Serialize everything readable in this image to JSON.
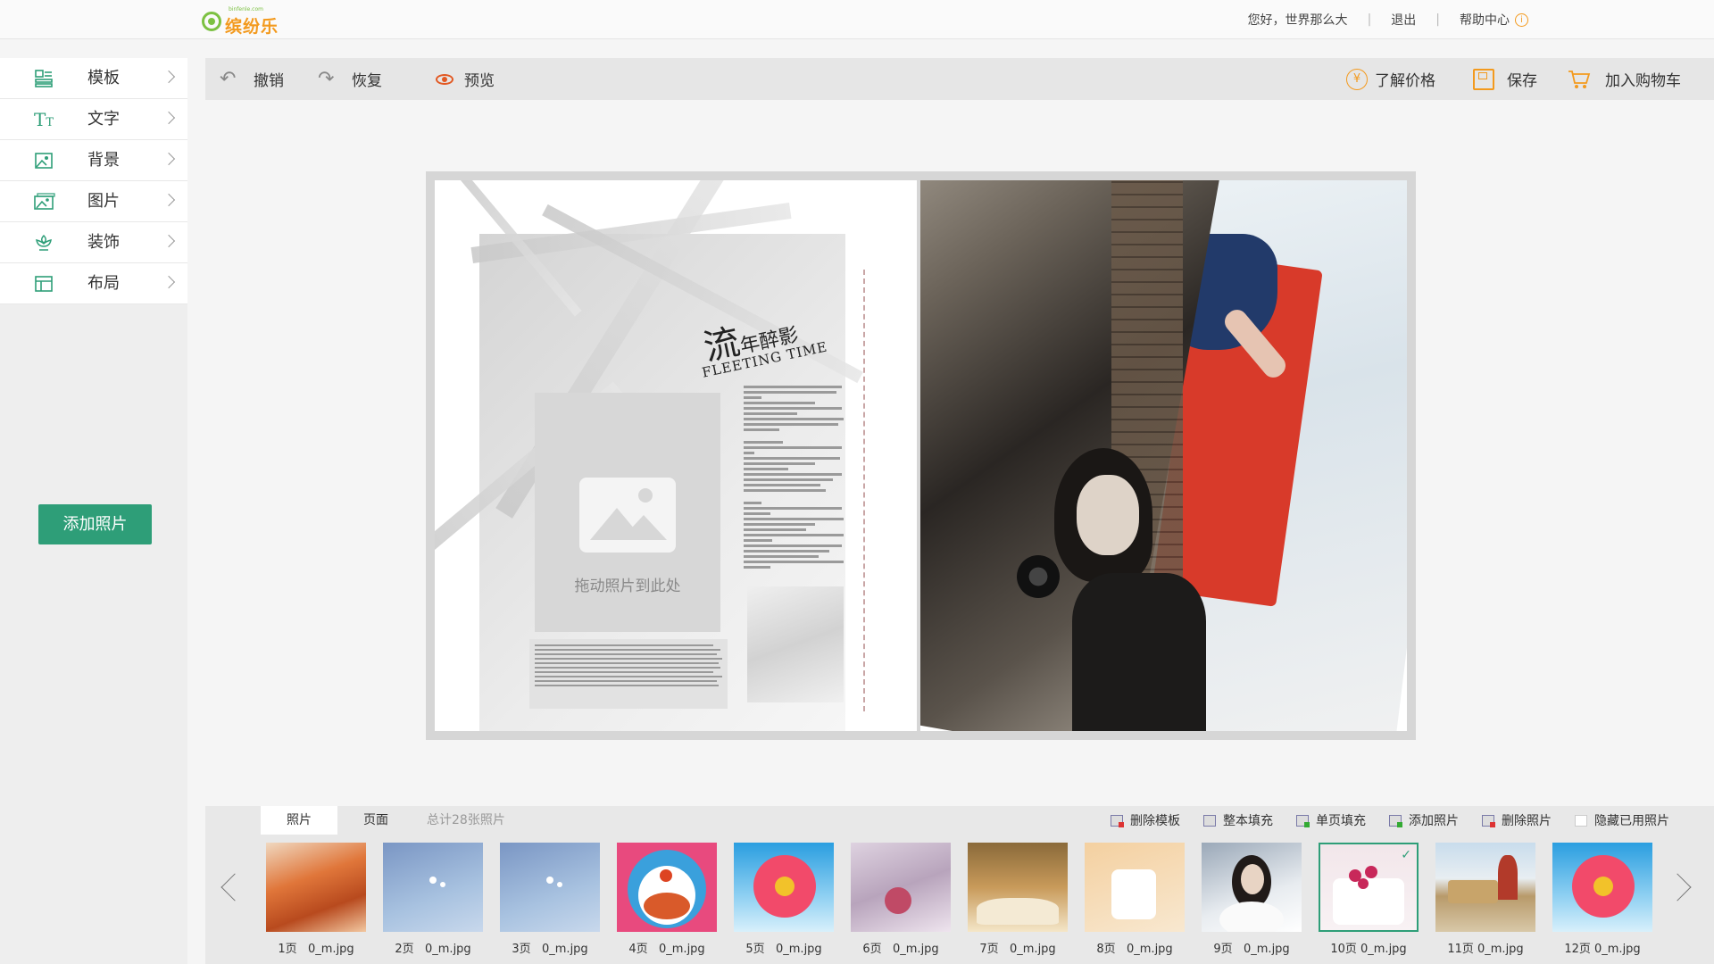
{
  "header": {
    "logo_text": "缤纷乐",
    "logo_sub": "binfenle.com",
    "greeting": "您好，世界那么大",
    "sep": "|",
    "logout": "退出",
    "help": "帮助中心"
  },
  "sidebar": {
    "items": [
      {
        "label": "模板",
        "icon": "template-icon"
      },
      {
        "label": "文字",
        "icon": "text-icon"
      },
      {
        "label": "背景",
        "icon": "background-icon"
      },
      {
        "label": "图片",
        "icon": "image-icon"
      },
      {
        "label": "装饰",
        "icon": "decoration-icon"
      },
      {
        "label": "布局",
        "icon": "layout-icon"
      }
    ],
    "add_photo": "添加照片"
  },
  "toolbar": {
    "undo": "撤销",
    "redo": "恢复",
    "preview": "预览",
    "price": "了解价格",
    "save": "保存",
    "cart": "加入购物车"
  },
  "canvas": {
    "title_cn_big": "流",
    "title_cn_rest": "年醉影",
    "title_en": "FLEETING TIME",
    "drop_label": "拖动照片到此处"
  },
  "bottom": {
    "tab_photos": "照片",
    "tab_pages": "页面",
    "count_text": "总计28张照片",
    "actions": [
      "删除模板",
      "整本填充",
      "单页填充",
      "添加照片",
      "删除照片",
      "隐藏已用照片"
    ],
    "thumbnails": [
      {
        "page": "1页",
        "file": "0_m.jpg",
        "selected": false
      },
      {
        "page": "2页",
        "file": "0_m.jpg",
        "selected": false
      },
      {
        "page": "3页",
        "file": "0_m.jpg",
        "selected": false
      },
      {
        "page": "4页",
        "file": "0_m.jpg",
        "selected": false
      },
      {
        "page": "5页",
        "file": "0_m.jpg",
        "selected": false
      },
      {
        "page": "6页",
        "file": "0_m.jpg",
        "selected": false
      },
      {
        "page": "7页",
        "file": "0_m.jpg",
        "selected": false
      },
      {
        "page": "8页",
        "file": "0_m.jpg",
        "selected": false
      },
      {
        "page": "9页",
        "file": "0_m.jpg",
        "selected": false
      },
      {
        "page": "10页",
        "file": "0_m.jpg",
        "selected": true
      },
      {
        "page": "11页",
        "file": "0_m.jpg",
        "selected": false
      },
      {
        "page": "12页",
        "file": "0_m.jpg",
        "selected": false
      }
    ]
  },
  "colors": {
    "accent": "#2e9e78",
    "orange": "#f39a1e"
  }
}
